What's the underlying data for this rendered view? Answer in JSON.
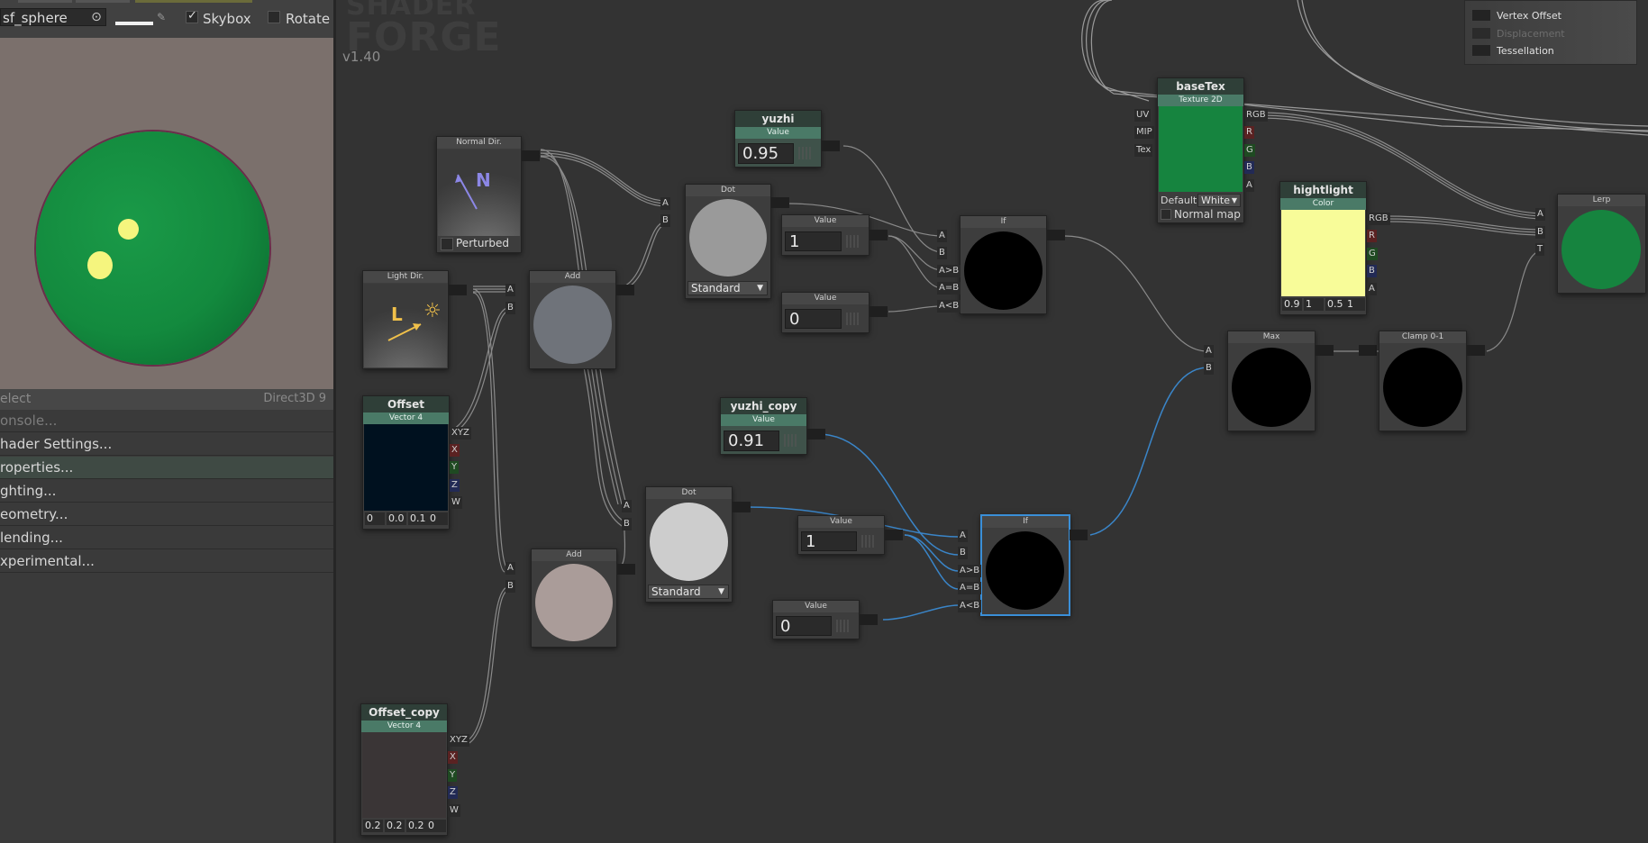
{
  "left_panel": {
    "object_field": "sf_sphere",
    "skybox_label": "Skybox",
    "rotate_label": "Rotate",
    "select_label": "elect",
    "renderer_label": "Direct3D 9",
    "menu": [
      {
        "label": "onsole...",
        "dim": true
      },
      {
        "label": "hader Settings..."
      },
      {
        "label": "roperties...",
        "selected": true
      },
      {
        "label": "ghting..."
      },
      {
        "label": "eometry..."
      },
      {
        "label": "lending..."
      },
      {
        "label": "xperimental..."
      }
    ]
  },
  "canvas": {
    "logo_line1": "SHADER",
    "logo_line2": "FORGE",
    "version": "v1.40"
  },
  "top_right_panel": {
    "items": [
      "Vertex Offset",
      "Displacement",
      "Tessellation"
    ]
  },
  "nodes": {
    "normal_dir": {
      "title": "Normal Dir.",
      "perturbed_label": "Perturbed",
      "glyph": "N"
    },
    "light_dir": {
      "title": "Light Dir.",
      "glyph": "L"
    },
    "offset": {
      "name": "Offset",
      "type": "Vector 4",
      "outputs": [
        "XYZ",
        "X",
        "Y",
        "Z",
        "W"
      ],
      "values": [
        "0",
        "0.0",
        "0.1",
        "0"
      ]
    },
    "offset_copy": {
      "name": "Offset_copy",
      "type": "Vector 4",
      "outputs": [
        "XYZ",
        "X",
        "Y",
        "Z",
        "W"
      ],
      "values": [
        "0.2",
        "0.2",
        "0.2",
        "0"
      ]
    },
    "add1": {
      "title": "Add",
      "inputs": [
        "A",
        "B"
      ]
    },
    "add2": {
      "title": "Add",
      "inputs": [
        "A",
        "B"
      ]
    },
    "dot1": {
      "title": "Dot",
      "inputs": [
        "A",
        "B"
      ],
      "mode": "Standard"
    },
    "dot2": {
      "title": "Dot",
      "inputs": [
        "A",
        "B"
      ],
      "mode": "Standard"
    },
    "yuzhi": {
      "name": "yuzhi",
      "type": "Value",
      "value": "0.95"
    },
    "yuzhi_copy": {
      "name": "yuzhi_copy",
      "type": "Value",
      "value": "0.91"
    },
    "value1": {
      "title": "Value",
      "value": "1"
    },
    "value2": {
      "title": "Value",
      "value": "0"
    },
    "value3": {
      "title": "Value",
      "value": "1"
    },
    "value4": {
      "title": "Value",
      "value": "0"
    },
    "if1": {
      "title": "If",
      "inputs": [
        "A",
        "B",
        "A>B",
        "A=B",
        "A<B"
      ]
    },
    "if2": {
      "title": "If",
      "inputs": [
        "A",
        "B",
        "A>B",
        "A=B",
        "A<B"
      ]
    },
    "basetex": {
      "name": "baseTex",
      "type": "Texture 2D",
      "inputs": [
        "UV",
        "MIP",
        "Tex"
      ],
      "outputs": [
        "RGB",
        "R",
        "G",
        "B",
        "A"
      ],
      "default_label": "Default",
      "default_value": "White",
      "normal_map_label": "Normal map"
    },
    "hightlight": {
      "name": "hightlight",
      "type": "Color",
      "outputs": [
        "RGB",
        "R",
        "G",
        "B",
        "A"
      ],
      "values": [
        "0.9",
        "1",
        "0.5",
        "1"
      ],
      "color": "#f8fc99"
    },
    "max": {
      "title": "Max",
      "inputs": [
        "A",
        "B"
      ]
    },
    "clamp": {
      "title": "Clamp 0-1"
    },
    "lerp": {
      "title": "Lerp",
      "inputs": [
        "A",
        "B",
        "T"
      ]
    }
  },
  "colors": {
    "sphere_green": "#138a3e",
    "highlight_yellow": "#f5f57e",
    "selection_blue": "#3a8fd8",
    "preview_bg": "#7b706c"
  }
}
